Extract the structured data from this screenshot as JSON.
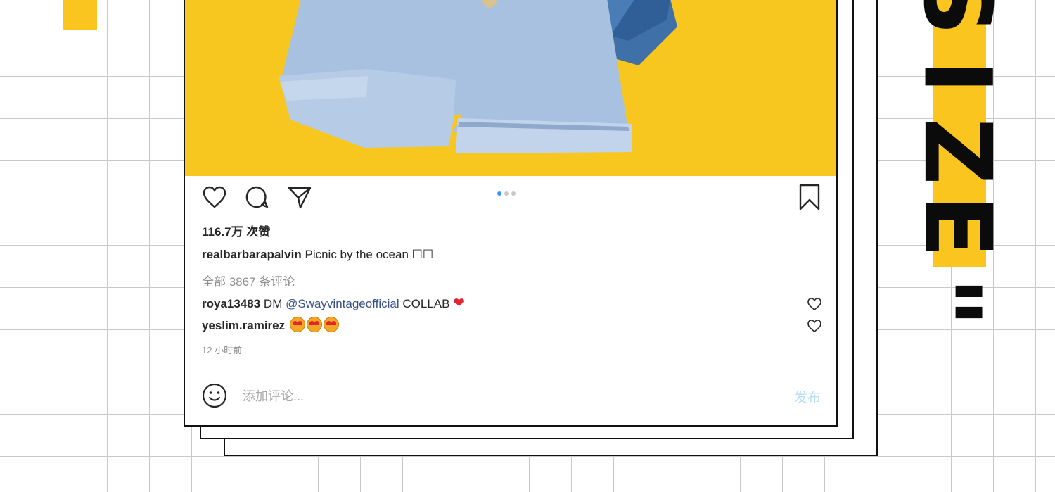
{
  "post": {
    "likes": "116.7万 次赞",
    "caption": {
      "username": "realbarbarapalvin",
      "text": "Picnic by the ocean ☐☐"
    },
    "view_all_comments": "全部 3867 条评论",
    "comments": [
      {
        "username": "roya13483",
        "prefix": "DM",
        "mention": "@Swayvintageofficial",
        "suffix": "COLLAB",
        "emoji": "❤"
      },
      {
        "username": "yeslim.ramirez",
        "emoji_count": 3
      }
    ],
    "timestamp": "12 小时前",
    "carousel": {
      "total": 3,
      "active": 1
    }
  },
  "comment_bar": {
    "placeholder": "添加评论...",
    "post_label": "发布"
  },
  "decor": {
    "vertical_title_letters": [
      "S",
      "I",
      "Z",
      "E",
      "\""
    ]
  },
  "colors": {
    "accent_yellow": "#f9c51e",
    "link_blue": "#385185",
    "dot_active": "#3897f0",
    "post_button": "#b2dffc",
    "heart_red": "#e0262f"
  },
  "icons": {
    "actions": [
      "heart-icon",
      "comment-icon",
      "share-icon",
      "bookmark-icon"
    ],
    "comment_bar": "smiley-icon"
  }
}
